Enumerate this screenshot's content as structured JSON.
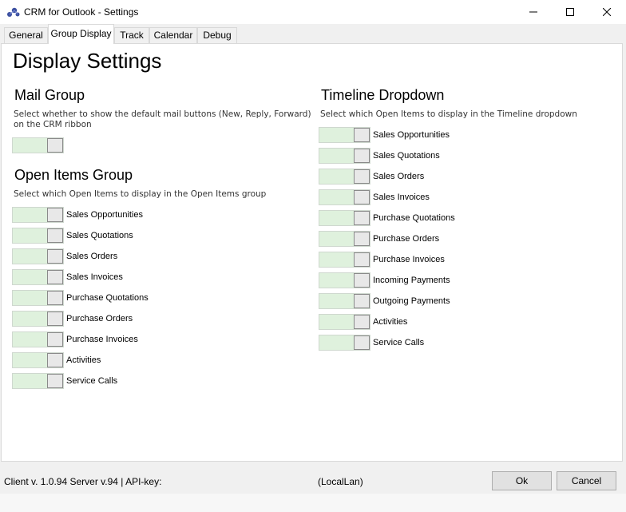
{
  "window": {
    "title": "CRM for Outlook - Settings",
    "icon": "crm-app-icon",
    "controls": [
      "minimize-icon",
      "maximize-icon",
      "close-icon"
    ]
  },
  "tabs": [
    {
      "label": "General",
      "active": false
    },
    {
      "label": "Group Display",
      "active": true
    },
    {
      "label": "Track",
      "active": false
    },
    {
      "label": "Calendar",
      "active": false
    },
    {
      "label": "Debug",
      "active": false
    }
  ],
  "page": {
    "title": "Display Settings"
  },
  "mail_group": {
    "title": "Mail Group",
    "description_1": "Select whether to show the default mail buttons (New, Reply, Forward)",
    "description_2": "on the CRM ribbon",
    "toggle_state": "on"
  },
  "open_items_group": {
    "title": "Open Items Group",
    "description": "Select which Open Items to display in the Open Items group",
    "items": [
      {
        "label": "Sales Opportunities",
        "state": "on"
      },
      {
        "label": "Sales Quotations",
        "state": "on"
      },
      {
        "label": "Sales Orders",
        "state": "on"
      },
      {
        "label": "Sales Invoices",
        "state": "on"
      },
      {
        "label": "Purchase Quotations",
        "state": "on"
      },
      {
        "label": "Purchase Orders",
        "state": "on"
      },
      {
        "label": "Purchase Invoices",
        "state": "on"
      },
      {
        "label": "Activities",
        "state": "on"
      },
      {
        "label": "Service Calls",
        "state": "on"
      }
    ]
  },
  "timeline_dropdown": {
    "title": "Timeline Dropdown",
    "description": "Select which Open Items to display in the Timeline dropdown",
    "items": [
      {
        "label": "Sales Opportunities",
        "state": "on"
      },
      {
        "label": "Sales Quotations",
        "state": "on"
      },
      {
        "label": "Sales Orders",
        "state": "on"
      },
      {
        "label": "Sales Invoices",
        "state": "on"
      },
      {
        "label": "Purchase Quotations",
        "state": "on"
      },
      {
        "label": "Purchase Orders",
        "state": "on"
      },
      {
        "label": "Purchase Invoices",
        "state": "on"
      },
      {
        "label": "Incoming Payments",
        "state": "on"
      },
      {
        "label": "Outgoing Payments",
        "state": "on"
      },
      {
        "label": "Activities",
        "state": "on"
      },
      {
        "label": "Service Calls",
        "state": "on"
      }
    ]
  },
  "footer": {
    "client_info": "Client v. 1.0.94 Server v.94 | API-key:",
    "connection": "(LocalLan)",
    "ok_label": "Ok",
    "cancel_label": "Cancel"
  },
  "colors": {
    "toggle_on": "#dff1dd",
    "panel_bg": "#ffffff",
    "window_bg": "#f0f0f0"
  }
}
